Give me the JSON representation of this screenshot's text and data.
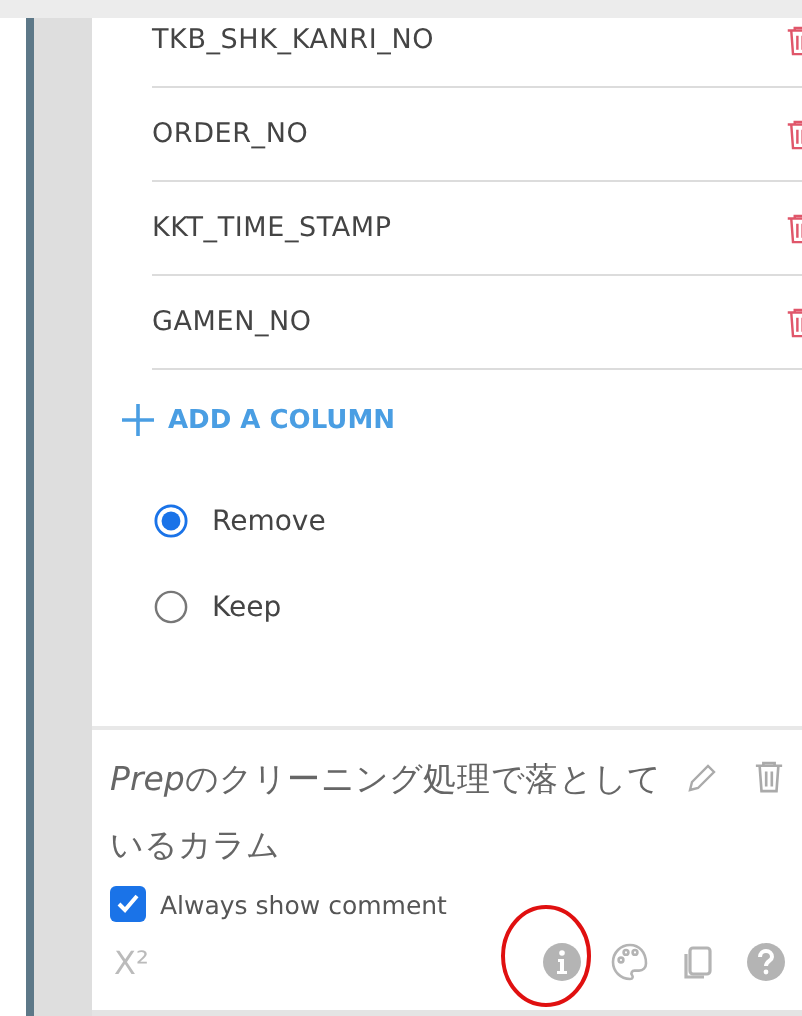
{
  "columns": [
    {
      "name": "TKB_SHK_KANRI_NO"
    },
    {
      "name": "ORDER_NO"
    },
    {
      "name": "KKT_TIME_STAMP"
    },
    {
      "name": "GAMEN_NO"
    }
  ],
  "add_column": {
    "label": "ADD A COLUMN"
  },
  "options": [
    {
      "label": "Remove",
      "selected": true
    },
    {
      "label": "Keep",
      "selected": false
    }
  ],
  "comment": {
    "italic_lead": "Prep",
    "text": "のクリーニング処理で落としているカラム",
    "always_show": {
      "label": "Always show comment",
      "checked": true
    }
  },
  "toolbar": {
    "superscript": "X²"
  }
}
